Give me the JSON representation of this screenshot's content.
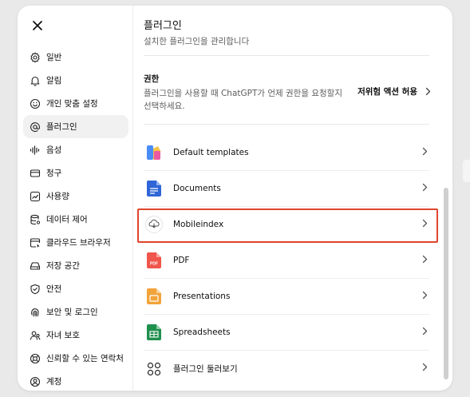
{
  "sidebar": {
    "close_label": "×",
    "items": [
      {
        "label": "일반",
        "icon": "gear-icon"
      },
      {
        "label": "알림",
        "icon": "bell-icon"
      },
      {
        "label": "개인 맞춤 설정",
        "icon": "smile-icon"
      },
      {
        "label": "플러그인",
        "icon": "at-icon",
        "active": true
      },
      {
        "label": "음성",
        "icon": "waveform-icon"
      },
      {
        "label": "청구",
        "icon": "card-icon"
      },
      {
        "label": "사용량",
        "icon": "chart-icon"
      },
      {
        "label": "데이터 제어",
        "icon": "database-icon"
      },
      {
        "label": "클라우드 브라우저",
        "icon": "browser-icon"
      },
      {
        "label": "저장 공간",
        "icon": "drive-icon"
      },
      {
        "label": "안전",
        "icon": "shield-icon"
      },
      {
        "label": "보안 및 로그인",
        "icon": "fingerprint-icon"
      },
      {
        "label": "자녀 보호",
        "icon": "people-icon"
      },
      {
        "label": "신뢰할 수 있는 연락처",
        "icon": "lifebuoy-icon"
      },
      {
        "label": "계정",
        "icon": "user-circle-icon"
      }
    ]
  },
  "main": {
    "title": "플러그인",
    "subtitle": "설치한 플러그인을 관리합니다",
    "permission": {
      "title": "권한",
      "description": "플러그인을 사용할 때 ChatGPT가 언제 권한을 요청할지 선택하세요.",
      "value": "저위험 액션 허용"
    },
    "plugins": [
      {
        "label": "Default templates",
        "icon": "templates-icon"
      },
      {
        "label": "Documents",
        "icon": "docs-icon"
      },
      {
        "label": "Mobileindex",
        "icon": "mobileindex-icon",
        "highlighted": true
      },
      {
        "label": "PDF",
        "icon": "pdf-icon",
        "badge": "PDF"
      },
      {
        "label": "Presentations",
        "icon": "slides-icon"
      },
      {
        "label": "Spreadsheets",
        "icon": "sheets-icon"
      },
      {
        "label": "플러그인 둘러보기",
        "icon": "grid-icon"
      }
    ]
  },
  "colors": {
    "highlight": "#e0452e",
    "active_bg": "#f1f1f1",
    "pdf_red": "#f0564b",
    "docs_blue": "#2f65d6",
    "sheets_green": "#1f8f4e",
    "slides_orange": "#f2a33a"
  }
}
